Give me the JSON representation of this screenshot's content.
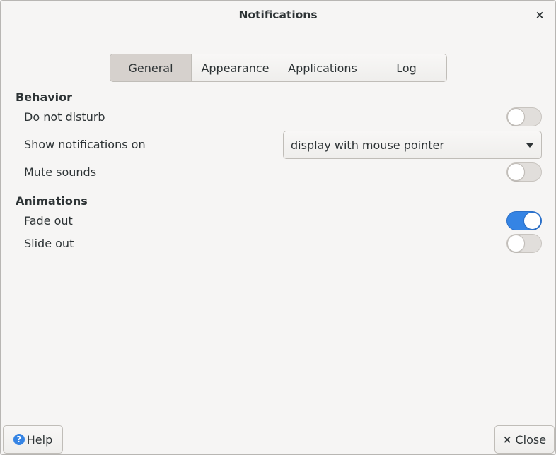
{
  "window": {
    "title": "Notifications",
    "close_glyph": "×"
  },
  "tabs": [
    {
      "label": "General",
      "active": true
    },
    {
      "label": "Appearance",
      "active": false
    },
    {
      "label": "Applications",
      "active": false
    },
    {
      "label": "Log",
      "active": false
    }
  ],
  "behavior": {
    "title": "Behavior",
    "do_not_disturb": {
      "label": "Do not disturb",
      "on": false
    },
    "show_on": {
      "label": "Show notifications on",
      "value": "display with mouse pointer"
    },
    "mute_sounds": {
      "label": "Mute sounds",
      "on": false
    }
  },
  "animations": {
    "title": "Animations",
    "fade_out": {
      "label": "Fade out",
      "on": true
    },
    "slide_out": {
      "label": "Slide out",
      "on": false
    }
  },
  "footer": {
    "help_label": "Help",
    "help_icon": "?",
    "close_label": "Close",
    "close_glyph": "×"
  },
  "colors": {
    "accent": "#3584e4",
    "background": "#f6f5f4",
    "text": "#2e3436"
  },
  "icons": {
    "help": "help-icon",
    "close": "close-icon",
    "dropdown": "chevron-down-icon"
  }
}
